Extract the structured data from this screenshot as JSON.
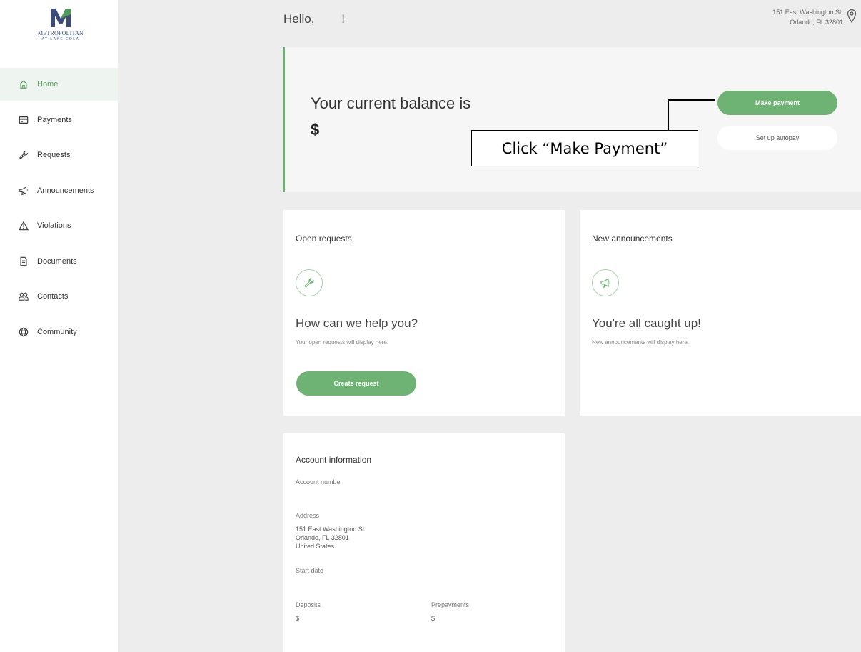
{
  "sidebar": {
    "logo": {
      "name": "METROPOLITAN",
      "sub": "AT LAKE EOLA"
    },
    "items": [
      {
        "label": "Home",
        "icon": "home-icon",
        "active": true
      },
      {
        "label": "Payments",
        "icon": "payment-card-icon"
      },
      {
        "label": "Requests",
        "icon": "wrench-icon"
      },
      {
        "label": "Announcements",
        "icon": "megaphone-icon"
      },
      {
        "label": "Violations",
        "icon": "warning-icon"
      },
      {
        "label": "Documents",
        "icon": "document-icon"
      },
      {
        "label": "Contacts",
        "icon": "contacts-icon"
      },
      {
        "label": "Community",
        "icon": "globe-icon"
      }
    ]
  },
  "header": {
    "greeting": "Hello,        !",
    "address_line1": "151 East Washington St.",
    "address_line2": "Orlando, FL 32801"
  },
  "balance": {
    "title": "Your current balance is",
    "amount": "$",
    "make_payment": "Make payment",
    "setup_autopay": "Set up autopay",
    "callout": "Click “Make Payment”"
  },
  "requests": {
    "title": "Open requests",
    "heading": "How can we help you?",
    "sub": "Your open requests will display here.",
    "button": "Create request"
  },
  "announcements": {
    "title": "New announcements",
    "heading": "You're all caught up!",
    "sub": "New announcements will display here."
  },
  "account": {
    "title": "Account information",
    "account_number_label": "Account number",
    "address_label": "Address",
    "address_line1": "151 East Washington St.",
    "address_line2": "Orlando, FL 32801",
    "address_line3": "United States",
    "start_date_label": "Start date",
    "deposits_label": "Deposits",
    "deposits_value": "$",
    "prepayments_label": "Prepayments",
    "prepayments_value": "$"
  },
  "colors": {
    "accent": "#6fb374",
    "background": "#ededed"
  }
}
